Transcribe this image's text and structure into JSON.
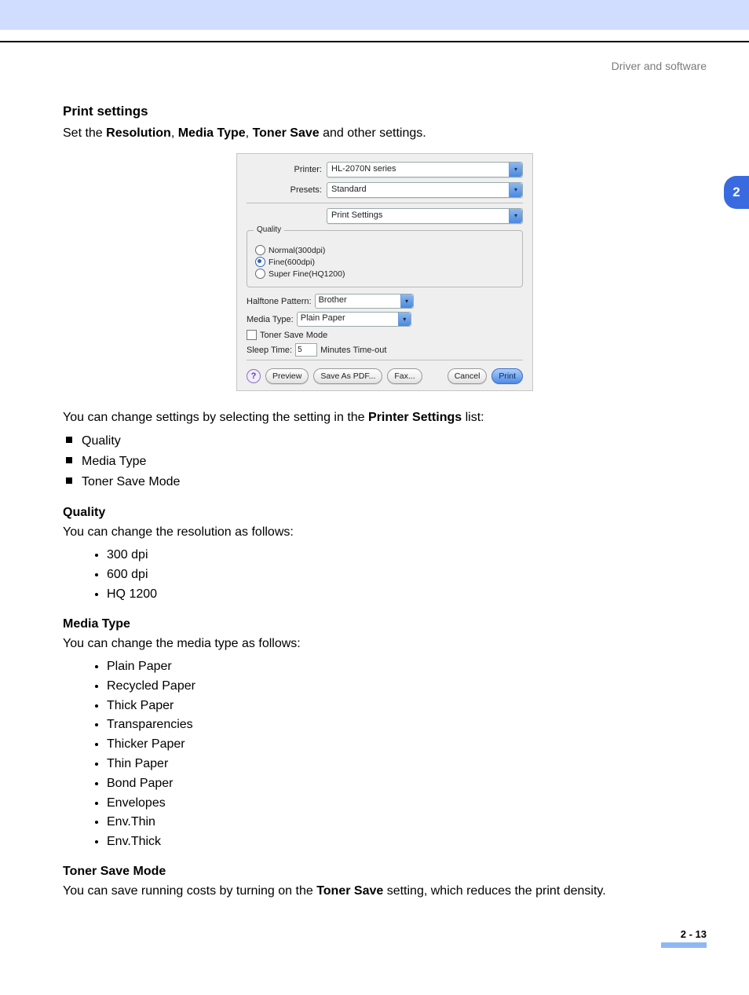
{
  "header": {
    "breadcrumb": "Driver and software",
    "chapter_tab": "2"
  },
  "section": {
    "title": "Print settings",
    "intro_pre": "Set the ",
    "intro_bold1": "Resolution",
    "intro_sep1": ", ",
    "intro_bold2": "Media Type",
    "intro_sep2": ", ",
    "intro_bold3": "Toner Save",
    "intro_post": " and other settings."
  },
  "dialog": {
    "labels": {
      "printer": "Printer:",
      "presets": "Presets:",
      "halftone": "Halftone Pattern:",
      "mediatype": "Media Type:",
      "toner_save": "Toner Save Mode",
      "sleep_time": "Sleep Time:",
      "minutes": "Minutes Time-out"
    },
    "values": {
      "printer": "HL-2070N series",
      "presets": "Standard",
      "panel": "Print Settings",
      "halftone": "Brother",
      "mediatype": "Plain Paper",
      "sleep_input": "5"
    },
    "quality": {
      "legend": "Quality",
      "opt1": "Normal(300dpi)",
      "opt2": "Fine(600dpi)",
      "opt3": "Super Fine(HQ1200)"
    },
    "buttons": {
      "help": "?",
      "preview": "Preview",
      "save_pdf": "Save As PDF...",
      "fax": "Fax...",
      "cancel": "Cancel",
      "print": "Print"
    }
  },
  "after_dialog": {
    "line_pre": "You can change settings by selecting the setting in the ",
    "line_bold": "Printer Settings",
    "line_post": " list:",
    "square_items": [
      "Quality",
      "Media Type",
      "Toner Save Mode"
    ]
  },
  "quality": {
    "heading": "Quality",
    "text": "You can change the resolution as follows:",
    "items": [
      "300 dpi",
      "600 dpi",
      "HQ 1200"
    ]
  },
  "mediatype": {
    "heading": "Media Type",
    "text": "You can change the media type as follows:",
    "items": [
      "Plain Paper",
      "Recycled Paper",
      "Thick Paper",
      "Transparencies",
      "Thicker Paper",
      "Thin Paper",
      "Bond Paper",
      "Envelopes",
      "Env.Thin",
      "Env.Thick"
    ]
  },
  "toner": {
    "heading": "Toner Save Mode",
    "text_pre": "You can save running costs by turning on the ",
    "text_bold": "Toner Save",
    "text_post": " setting, which reduces the print density."
  },
  "page_number": "2 - 13"
}
